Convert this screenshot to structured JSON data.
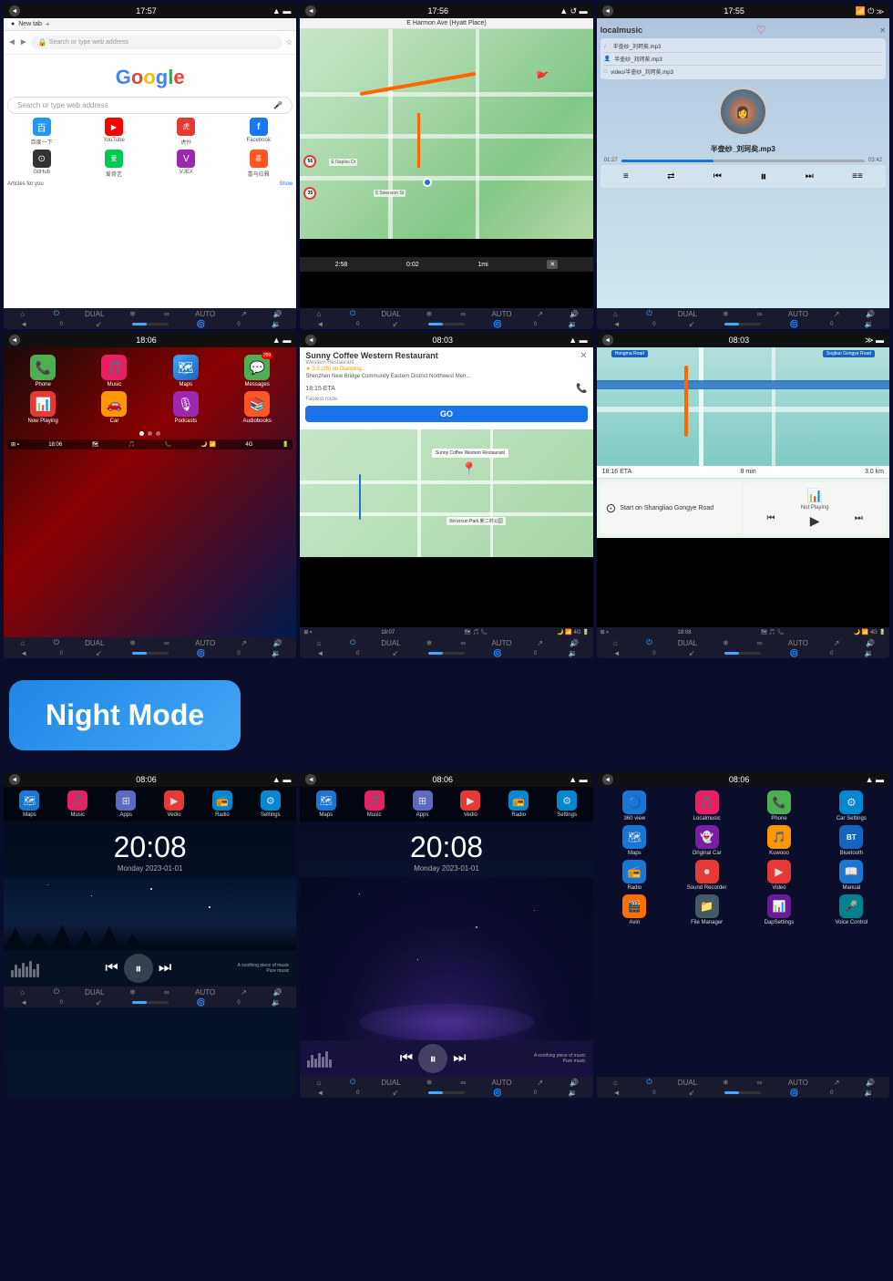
{
  "screens": [
    {
      "id": "browser",
      "time": "17:57",
      "type": "browser",
      "content": {
        "tab": "New tab",
        "search_placeholder": "Search or type web address",
        "google_text": "Google",
        "shortcuts": [
          {
            "name": "百度一下",
            "color": "#2196F3",
            "icon": "百"
          },
          {
            "name": "YouTube",
            "color": "#FF0000",
            "icon": "▶"
          },
          {
            "name": "虎扑",
            "color": "#e53935",
            "icon": "虎"
          },
          {
            "name": "Facebook",
            "color": "#1877F2",
            "icon": "f"
          },
          {
            "name": "GitHub",
            "color": "#333",
            "icon": "⊙"
          },
          {
            "name": "爱奇艺",
            "color": "#00c853",
            "icon": "爱"
          },
          {
            "name": "VJEX",
            "color": "#9c27b0",
            "icon": "V"
          },
          {
            "name": "喜马拉雅",
            "color": "#ff5722",
            "icon": "喜"
          }
        ],
        "articles_label": "Articles for you",
        "show_label": "Show"
      }
    },
    {
      "id": "navigation",
      "time": "17:56",
      "type": "navigation",
      "content": {
        "destination": "E Harmon Ave (Hyatt Place)",
        "eta": "2:58",
        "distance1": "0:02",
        "distance2": "1mi",
        "speed_limit": "56",
        "speed_limit2": "35",
        "roads": [
          "E Harmon Ave",
          "S Swenson St",
          "E Naples Dr"
        ]
      }
    },
    {
      "id": "music",
      "time": "17:55",
      "type": "music",
      "content": {
        "title": "localmusic",
        "song1": "半壶纱_刘珂矣.mp3",
        "song2": "半壶纱_刘珂矣.mp3",
        "song3": "video/半壶纱_刘珂矣.mp3",
        "current_song": "半壶纱_刘珂矣.mp3",
        "current_time": "01:27",
        "total_time": "03:42",
        "progress": 38
      }
    },
    {
      "id": "carplay_home",
      "time": "18:06",
      "type": "carplay_home",
      "content": {
        "apps": [
          {
            "name": "Phone",
            "color": "#4CAF50",
            "icon": "📞"
          },
          {
            "name": "Music",
            "color": "#e91e63",
            "icon": "🎵"
          },
          {
            "name": "Maps",
            "color": "#1976D2",
            "icon": "🗺"
          },
          {
            "name": "Messages",
            "color": "#4CAF50",
            "icon": "💬",
            "badge": "259"
          },
          {
            "name": "Now Playing",
            "color": "#e53935",
            "icon": "🎙"
          },
          {
            "name": "Car",
            "color": "#ff9800",
            "icon": "🚗"
          },
          {
            "name": "Podcasts",
            "color": "#9c27b0",
            "icon": "🎙"
          },
          {
            "name": "Audiobooks",
            "color": "#ff5722",
            "icon": "📚"
          }
        ],
        "status_time": "18:06",
        "signal": "4G"
      }
    },
    {
      "id": "maps_poi",
      "time": "08:03",
      "type": "maps_poi",
      "content": {
        "poi_name": "Sunny Coffee Western Restaurant",
        "poi_type": "Western Restaurant",
        "poi_rating": "★ 3.5 (26) on Dianping...",
        "poi_address": "Shenzhen New Bridge Community Eastern District Northwest Men...",
        "eta": "18:15 ETA",
        "route_type": "Fastest route",
        "go_label": "GO",
        "status_time": "18:07",
        "signal": "4G"
      }
    },
    {
      "id": "carplay_nav",
      "time": "08:03",
      "type": "carplay_nav",
      "content": {
        "road": "Hongma Road",
        "destination_road": "Sogliao Gongye Road",
        "eta": "18:16 ETA",
        "duration": "8 min",
        "distance": "3.0 km",
        "start_label": "Start on Shangliao Gongye Road",
        "not_playing": "Not Playing",
        "status_time": "18:08",
        "signal": "4G"
      }
    }
  ],
  "night_mode_label": "Night Mode",
  "night_screens": [
    {
      "id": "night1",
      "time": "08:06",
      "type": "night_home",
      "content": {
        "clock": "20:08",
        "date": "Monday  2023-01-01",
        "music_label1": "A soothing piece of music",
        "music_label2": "Pure music",
        "apps": [
          {
            "name": "Maps",
            "color": "#1976D2",
            "icon": "🗺"
          },
          {
            "name": "Music",
            "color": "#e91e63",
            "icon": "🎵"
          },
          {
            "name": "Apps",
            "color": "#5c6bc0",
            "icon": "⊞"
          },
          {
            "name": "Vedio",
            "color": "#e53935",
            "icon": "▶"
          },
          {
            "name": "Radio",
            "color": "#0288d1",
            "icon": "📻"
          },
          {
            "name": "Settings",
            "color": "#0288d1",
            "icon": "⚙"
          }
        ]
      }
    },
    {
      "id": "night2",
      "time": "08:06",
      "type": "night_home2",
      "content": {
        "clock": "20:08",
        "date": "Monday  2023-01-01",
        "music_label1": "A soothing piece of music",
        "music_label2": "Pure music",
        "apps": [
          {
            "name": "Maps",
            "color": "#1976D2",
            "icon": "🗺"
          },
          {
            "name": "Music",
            "color": "#e91e63",
            "icon": "🎵"
          },
          {
            "name": "Apps",
            "color": "#5c6bc0",
            "icon": "⊞"
          },
          {
            "name": "Vedio",
            "color": "#e53935",
            "icon": "▶"
          },
          {
            "name": "Radio",
            "color": "#0288d1",
            "icon": "📻"
          },
          {
            "name": "Settings",
            "color": "#0288d1",
            "icon": "⚙"
          }
        ]
      }
    },
    {
      "id": "night3",
      "time": "08:06",
      "type": "night_apps",
      "content": {
        "apps": [
          {
            "name": "360 view",
            "color": "#1976D2",
            "icon": "🔵"
          },
          {
            "name": "Localmusic",
            "color": "#e91e63",
            "icon": "🎵"
          },
          {
            "name": "Phone",
            "color": "#4CAF50",
            "icon": "📞"
          },
          {
            "name": "Car Settings",
            "color": "#0288d1",
            "icon": "⚙"
          },
          {
            "name": "Maps",
            "color": "#1976D2",
            "icon": "🗺"
          },
          {
            "name": "Original Car",
            "color": "#7b1fa2",
            "icon": "👻"
          },
          {
            "name": "Kuwooo",
            "color": "#ff9800",
            "icon": "🎵"
          },
          {
            "name": "Bluetooth",
            "color": "#1565c0",
            "icon": "BT"
          },
          {
            "name": "Radio",
            "color": "#1976D2",
            "icon": "📻"
          },
          {
            "name": "Sound Recorder",
            "color": "#e53935",
            "icon": "⏺"
          },
          {
            "name": "Video",
            "color": "#e53935",
            "icon": "▶"
          },
          {
            "name": "Manual",
            "color": "#1976D2",
            "icon": "📖"
          },
          {
            "name": "Avin",
            "color": "#ff6f00",
            "icon": "🎬"
          },
          {
            "name": "File Manager",
            "color": "#455a64",
            "icon": "📁"
          },
          {
            "name": "DapSettings",
            "color": "#6a1b9a",
            "icon": "📊"
          },
          {
            "name": "Voice Control",
            "color": "#00838f",
            "icon": "🎤"
          }
        ]
      }
    }
  ],
  "bottom_controls": {
    "row1_icons": [
      "⌂",
      "⏻",
      "DUAL",
      "❄",
      "∞",
      "AUTO",
      "↗",
      "🔊"
    ],
    "row2": {
      "back_icon": "◄",
      "zero1": "0",
      "temp": "0°C",
      "progress": 40,
      "zero2": "0",
      "vol_icon": "🔊"
    }
  }
}
